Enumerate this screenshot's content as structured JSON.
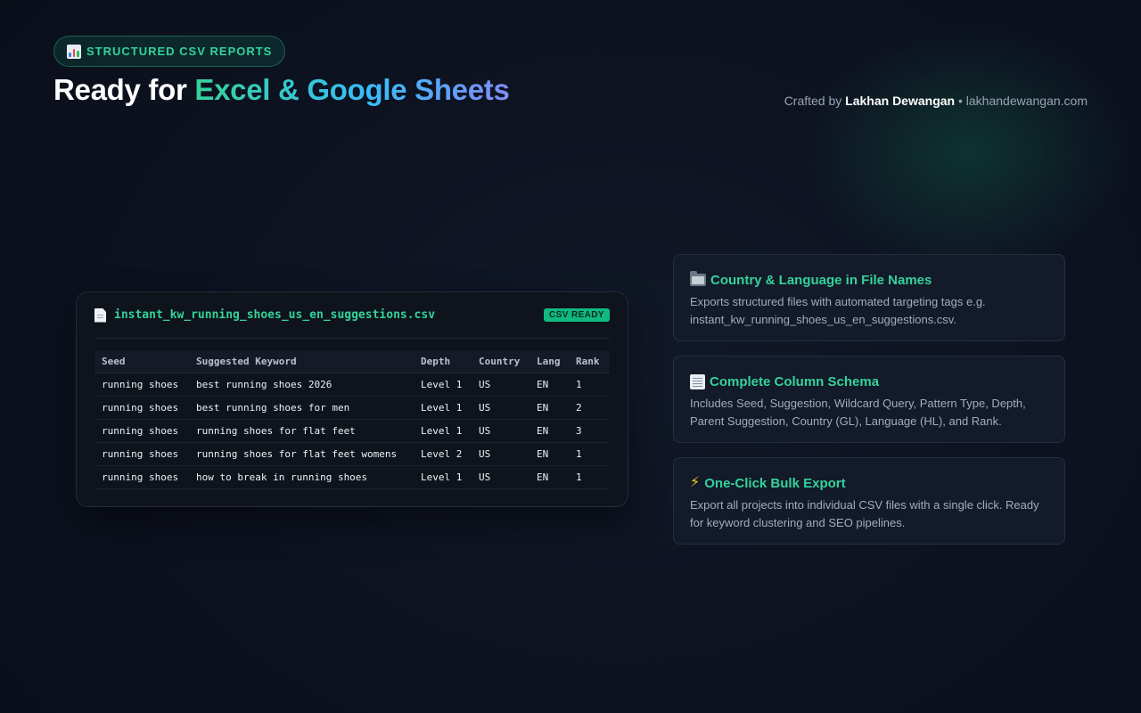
{
  "header": {
    "badge_label": "STRUCTURED CSV REPORTS",
    "badge_icon": "bar-chart-icon",
    "title_prefix": "Ready for ",
    "title_highlight": "Excel & Google Sheets",
    "credit_prefix": "Crafted by ",
    "credit_author": "Lakhan Dewangan",
    "credit_separator": " • ",
    "credit_site": "lakhandewangan.com"
  },
  "csv_preview": {
    "file_icon": "file-icon",
    "file_name": "instant_kw_running_shoes_us_en_suggestions.csv",
    "status_badge": "CSV READY",
    "columns": [
      "Seed",
      "Suggested Keyword",
      "Depth",
      "Country",
      "Lang",
      "Rank"
    ],
    "rows": [
      [
        "running shoes",
        "best running shoes 2026",
        "Level 1",
        "US",
        "EN",
        "1"
      ],
      [
        "running shoes",
        "best running shoes for men",
        "Level 1",
        "US",
        "EN",
        "2"
      ],
      [
        "running shoes",
        "running shoes for flat feet",
        "Level 1",
        "US",
        "EN",
        "3"
      ],
      [
        "running shoes",
        "running shoes for flat feet womens",
        "Level 2",
        "US",
        "EN",
        "1"
      ],
      [
        "running shoes",
        "how to break in running shoes",
        "Level 1",
        "US",
        "EN",
        "1"
      ]
    ]
  },
  "features": [
    {
      "icon": "folder-icon",
      "title": "Country & Language in File Names",
      "description": "Exports structured files with automated targeting tags e.g. instant_kw_running_shoes_us_en_suggestions.csv."
    },
    {
      "icon": "spreadsheet-icon",
      "title": "Complete Column Schema",
      "description": "Includes Seed, Suggestion, Wildcard Query, Pattern Type, Depth, Parent Suggestion, Country (GL), Language (HL), and Rank."
    },
    {
      "icon": "lightning-icon",
      "title": "One-Click Bulk Export",
      "description": "Export all projects into individual CSV files with a single click. Ready for keyword clustering and SEO pipelines."
    }
  ],
  "colors": {
    "accent": "#34d399",
    "background": "#0d1220",
    "card": "#131a2a"
  }
}
